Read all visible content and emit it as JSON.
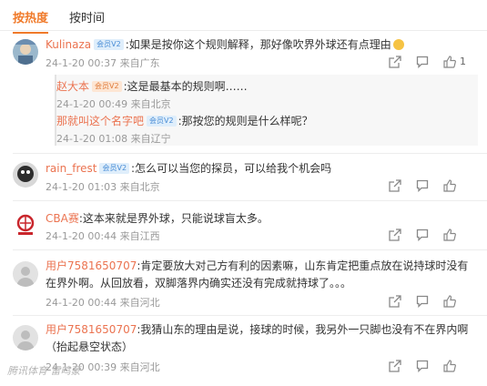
{
  "tabs": [
    "按热度",
    "按时间"
  ],
  "comments": [
    {
      "user": "Kulinaza",
      "badge": "会员V2",
      "text": ":如果是按你这个规则解释，那好像吹界外球还有点理由",
      "time": "24-1-20 00:37",
      "location": "来自广东",
      "likes": "1"
    },
    {
      "user": "rain_frest",
      "badge": "会员V2",
      "text": ":怎么可以当您的探员，可以给我个机会吗",
      "time": "24-1-20 01:03",
      "location": "来自北京"
    },
    {
      "user": "CBA赛",
      "text": ":这本来就是界外球，只能说球盲太多。",
      "time": "24-1-20 00:44",
      "location": "来自江西"
    },
    {
      "user": "用户7581650707",
      "text": ":肯定要放大对己方有利的因素嘛，山东肯定把重点放在说持球时没有在界外啊。从回放看，双脚落界内确实还没有完成就持球了。。。",
      "time": "24-1-20 00:44",
      "location": "来自河北"
    },
    {
      "user": "用户7581650707",
      "text": ":我猜山东的理由是说，接球的时候，我另外一只脚也没有不在界内啊（抬起悬空状态）",
      "time": "24-1-20 00:39",
      "location": "来自河北"
    }
  ],
  "replies": [
    {
      "user": "赵大本",
      "badge": "会员V2",
      "text": ":这是最基本的规则啊……",
      "time": "24-1-20 00:49",
      "location": "来自北京"
    },
    {
      "user": "那就叫这个名字吧",
      "badge": "会员V2",
      "text": ":那按您的规则是什么样呢？",
      "time": "24-1-20 01:08",
      "location": "来自辽宁"
    }
  ],
  "watermark": "腾讯体育 雷鸣蒙",
  "colors": {
    "accent": "#f07a2a",
    "username": "#eb7350",
    "meta": "#999999",
    "badge": "#4a8dd6"
  },
  "icons": [
    "share-icon",
    "comment-icon",
    "like-icon"
  ]
}
